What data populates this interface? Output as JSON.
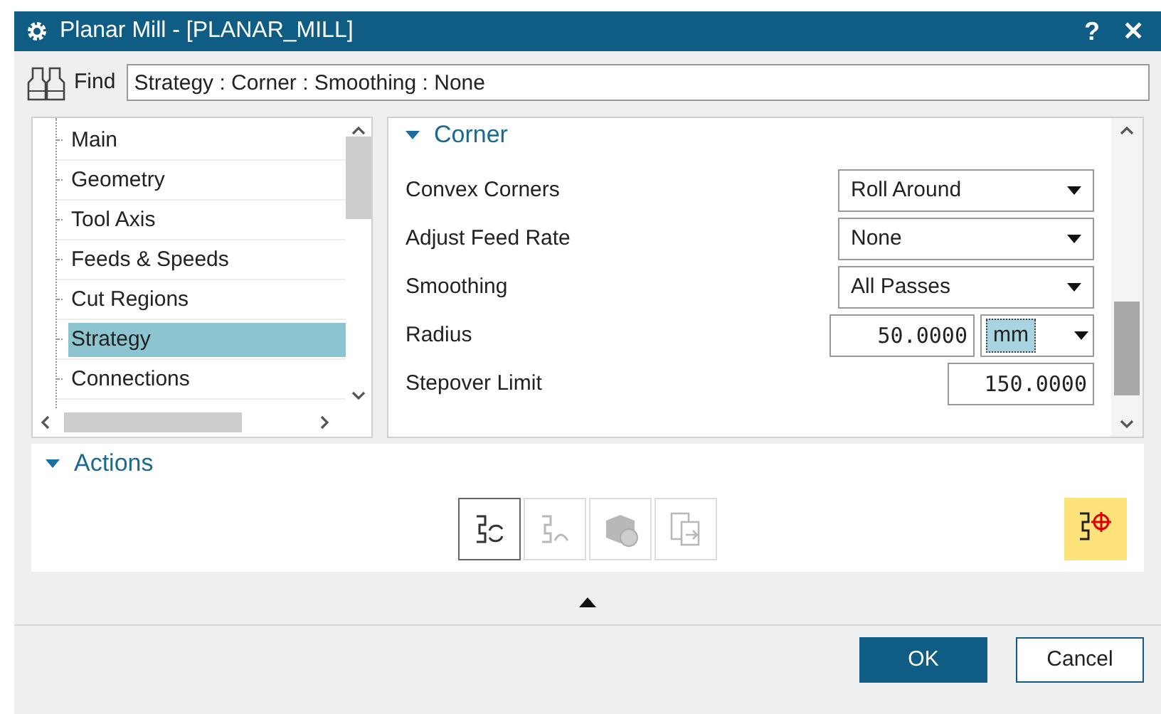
{
  "window": {
    "title": "Planar Mill - [PLANAR_MILL]",
    "help": "?",
    "close": "✕"
  },
  "find": {
    "label": "Find",
    "value": "Strategy : Corner : Smoothing : None"
  },
  "tree": {
    "items": [
      {
        "label": "Main",
        "selected": false
      },
      {
        "label": "Geometry",
        "selected": false
      },
      {
        "label": "Tool Axis",
        "selected": false
      },
      {
        "label": "Feeds & Speeds",
        "selected": false
      },
      {
        "label": "Cut Regions",
        "selected": false
      },
      {
        "label": "Strategy",
        "selected": true
      },
      {
        "label": "Connections",
        "selected": false
      }
    ]
  },
  "corner": {
    "title": "Corner",
    "expanded": true,
    "rows": [
      {
        "kind": "dropdown",
        "label": "Convex Corners",
        "value": "Roll Around"
      },
      {
        "kind": "dropdown",
        "label": "Adjust Feed Rate",
        "value": "None"
      },
      {
        "kind": "dropdown",
        "label": "Smoothing",
        "value": "All Passes"
      },
      {
        "kind": "number_unit",
        "label": "Radius",
        "value": "50.0000",
        "unit": "mm",
        "unit_focused": true
      },
      {
        "kind": "number",
        "label": "Stepover Limit",
        "value": "150.0000"
      }
    ]
  },
  "actions": {
    "title": "Actions",
    "expanded": true,
    "tools": [
      {
        "kind": "regenerate",
        "disabled": false
      },
      {
        "kind": "replay",
        "disabled": true
      },
      {
        "kind": "verify",
        "disabled": true
      },
      {
        "kind": "list",
        "disabled": true
      }
    ],
    "highlighted_tool": {
      "highlighted": true
    }
  },
  "buttons": [
    {
      "label": "OK",
      "kind": "primary"
    },
    {
      "label": "Cancel",
      "kind": "secondary"
    }
  ]
}
